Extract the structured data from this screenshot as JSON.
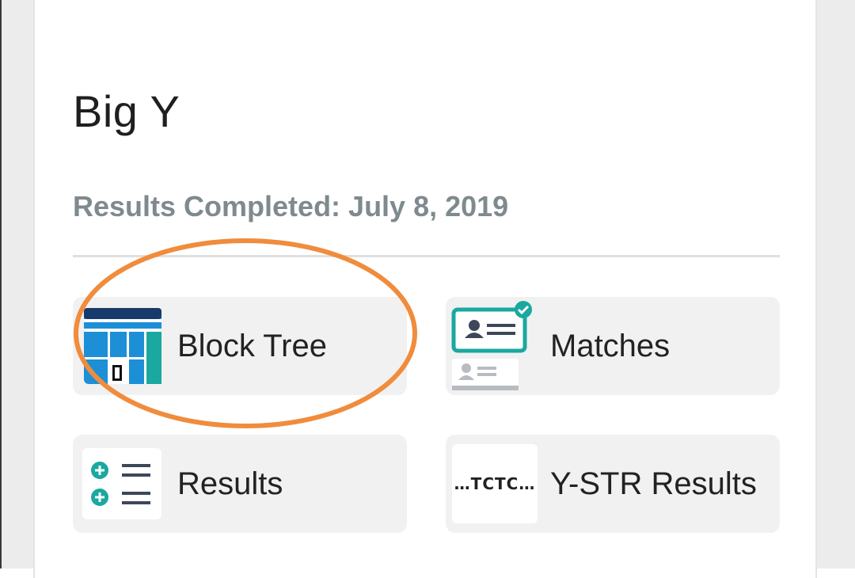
{
  "section": {
    "title": "Big Y",
    "completed_text": "Results Completed: July 8, 2019"
  },
  "tiles": [
    {
      "label": "Block Tree",
      "icon": "block-tree-icon"
    },
    {
      "label": "Matches",
      "icon": "matches-icon"
    },
    {
      "label": "Results",
      "icon": "results-list-icon"
    },
    {
      "label": "Y-STR Results",
      "icon": "tctc-sequence-icon",
      "icon_text": "…TCTC…"
    }
  ],
  "colors": {
    "annotation_circle": "#f08c3c",
    "teal": "#1aa8a0",
    "navy": "#163a6b",
    "blue": "#1d8fd6",
    "gray_text": "#7f8a8e"
  }
}
